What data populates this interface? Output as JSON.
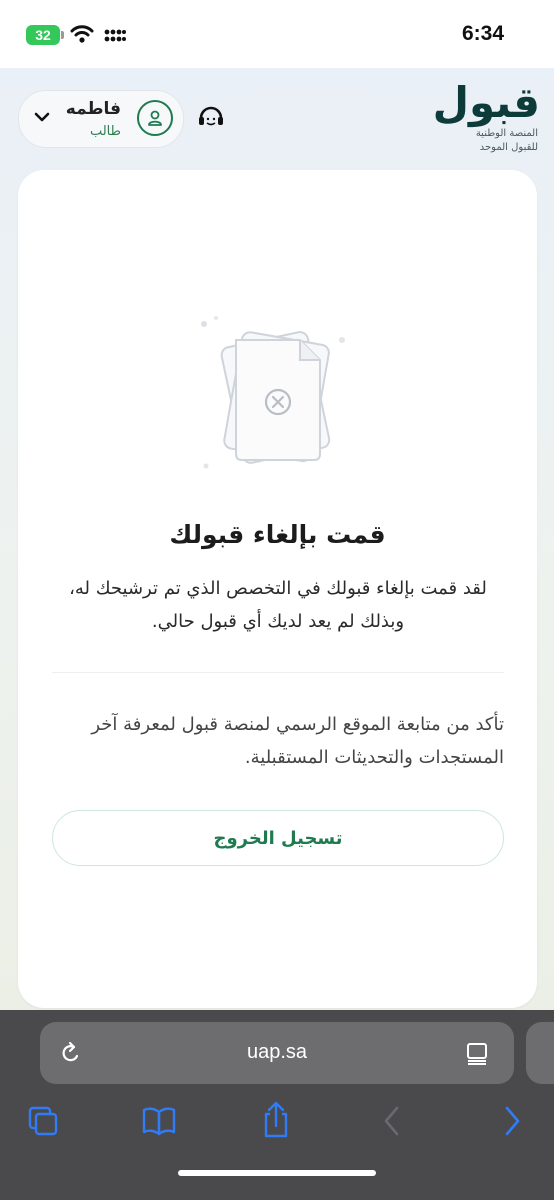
{
  "status_bar": {
    "time": "6:34",
    "battery": "32"
  },
  "header": {
    "user_name": "فاطمه",
    "user_role": "طالب",
    "logo_word": "قبول",
    "logo_line1": "المنصة الوطنية",
    "logo_line2": "للقبول الموحد"
  },
  "card": {
    "title": "قمت بإلغاء قبولك",
    "body": "لقد قمت بإلغاء قبولك في التخصص الذي تم ترشيحك له، وبذلك لم يعد لديك أي قبول حالي.",
    "note": "تأكد من متابعة الموقع الرسمي لمنصة قبول لمعرفة آخر المستجدات والتحديثات المستقبلية.",
    "logout_label": "تسجيل الخروج"
  },
  "browser": {
    "url": "uap.sa"
  },
  "colors": {
    "brand_green": "#1f7a4f",
    "logo_dark": "#0d3b3a",
    "ios_blue": "#2f7cf6"
  }
}
